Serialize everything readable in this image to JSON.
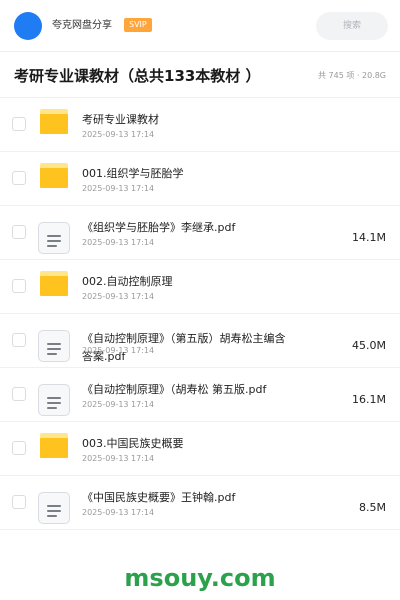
{
  "header": {
    "username": "夸克网盘分享",
    "badge": "SVIP",
    "search_placeholder": "搜索",
    "avatar_color": "#1f7cf2",
    "badge_color": "#ffa53a"
  },
  "title_bar": {
    "title": "考研专业课教材（总共133本教材 ）",
    "meta": "共 745 项 · 20.8G"
  },
  "items": [
    {
      "type": "folder",
      "icon": "folder-icon",
      "name": "考研专业课教材",
      "date": "2025-09-13 17:14",
      "size": ""
    },
    {
      "type": "folder",
      "icon": "folder-icon",
      "name": "001.组织学与胚胎学",
      "date": "2025-09-13 17:14",
      "size": ""
    },
    {
      "type": "file",
      "icon": "document-icon",
      "name": "《组织学与胚胎学》李继承.pdf",
      "date": "2025-09-13 17:14",
      "size": "14.1M"
    },
    {
      "type": "folder",
      "icon": "folder-icon",
      "name": "002.自动控制原理",
      "date": "2025-09-13 17:14",
      "size": ""
    },
    {
      "type": "file",
      "icon": "document-icon",
      "name": "《自动控制原理》（第五版）胡寿松主编含答案.pdf",
      "date": "2025-09-13 17:14",
      "size": "45.0M"
    },
    {
      "type": "file",
      "icon": "document-icon",
      "name": "《自动控制原理》（胡寿松 第五版.pdf",
      "date": "2025-09-13 17:14",
      "size": "16.1M"
    },
    {
      "type": "folder",
      "icon": "folder-icon",
      "name": "003.中国民族史概要",
      "date": "2025-09-13 17:14",
      "size": ""
    },
    {
      "type": "file",
      "icon": "document-icon",
      "name": "《中国民族史概要》王钟翰.pdf",
      "date": "2025-09-13 17:14",
      "size": "8.5M"
    }
  ],
  "watermark": "msouy.com",
  "colors": {
    "folder": "#ffc31f",
    "folder_tab": "#ffe68a",
    "watermark": "#2aa14a"
  }
}
